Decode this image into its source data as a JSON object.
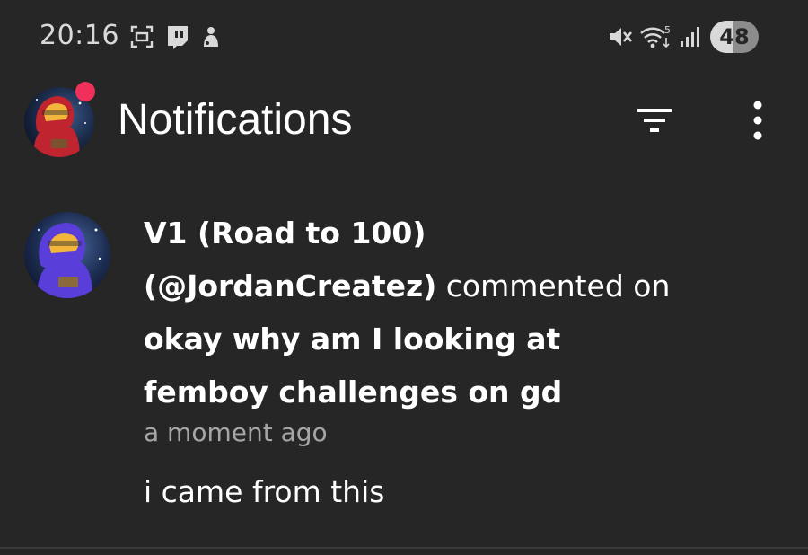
{
  "status_bar": {
    "time": "20:16",
    "battery_level": "48",
    "left_icons": [
      "screenshot-icon",
      "twitch-icon",
      "app-icon"
    ],
    "right_icons": [
      "mute-icon",
      "wifi-icon",
      "signal-icon"
    ]
  },
  "header": {
    "title": "Notifications",
    "has_unread": true,
    "icons": [
      "filter-icon",
      "more-vertical-icon"
    ]
  },
  "notification": {
    "author_name": "V1 (Road to 100)",
    "author_handle": "(@JordanCreatez)",
    "action": " commented on",
    "video_title_line1": "okay why am I looking at",
    "video_title_line2": "femboy challenges on gd",
    "timestamp": "a moment ago",
    "comment_text": "i came from this"
  },
  "colors": {
    "background": "#262626",
    "text_primary": "#ffffff",
    "text_secondary": "#a6a6a6",
    "unread_dot": "#f0305a",
    "avatar_header_accent": "#c0242f",
    "avatar_notif_accent": "#5a3ed9"
  }
}
